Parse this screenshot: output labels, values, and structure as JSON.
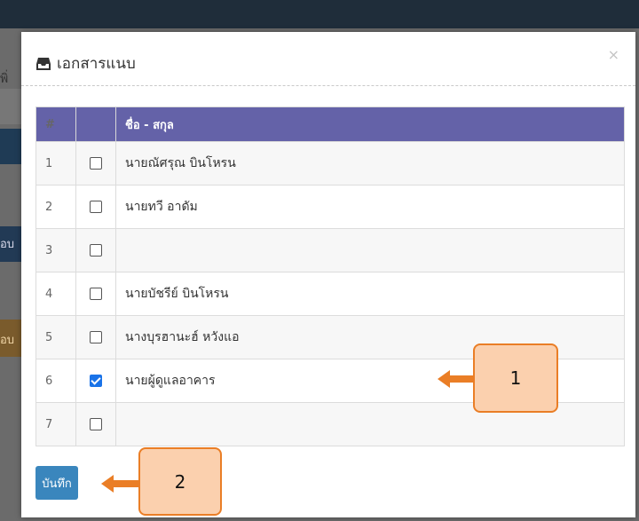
{
  "background": {
    "fragment_top": "พิ่",
    "fragment_mid": "อบ",
    "fragment_low": "อบ"
  },
  "modal": {
    "icon": "inbox-icon",
    "title": "เอกสารแนบ",
    "close_label": "×"
  },
  "table": {
    "headers": [
      "#",
      "",
      "ชื่อ - สกุล"
    ],
    "rows": [
      {
        "num": "1",
        "checked": false,
        "name": "นายณัศรุณ บินโหรน"
      },
      {
        "num": "2",
        "checked": false,
        "name": "นายทวี อาดัม"
      },
      {
        "num": "3",
        "checked": false,
        "name": ""
      },
      {
        "num": "4",
        "checked": false,
        "name": "นายบัชรีย์ บินโหรน"
      },
      {
        "num": "5",
        "checked": false,
        "name": "นางบุรฮานะฮ์ หวังแอ"
      },
      {
        "num": "6",
        "checked": true,
        "name": "นายผู้ดูแลอาคาร"
      },
      {
        "num": "7",
        "checked": false,
        "name": ""
      }
    ]
  },
  "save_button": {
    "label": "บันทึก",
    "color": "#3a86bd"
  },
  "annotations": [
    {
      "label": "1"
    },
    {
      "label": "2"
    }
  ],
  "colors": {
    "header_bg": "#6462a8",
    "checkbox_checked": "#1a73e8",
    "callout_fill": "#fbd0ae",
    "callout_border": "#ea7e26"
  }
}
